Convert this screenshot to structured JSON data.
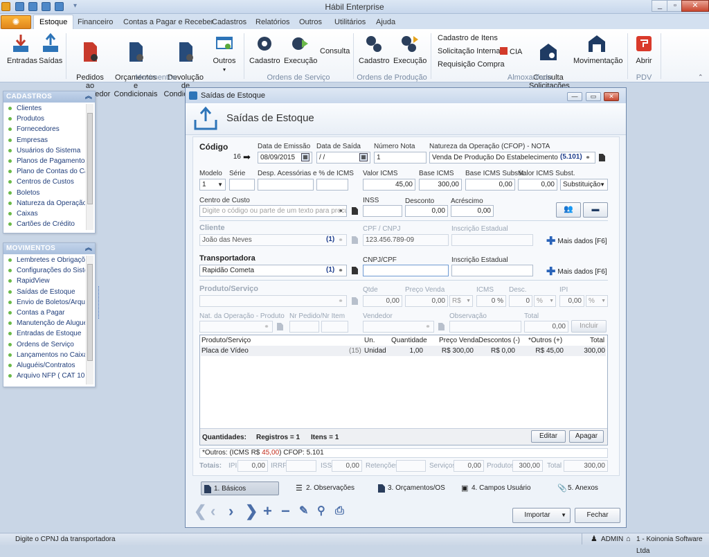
{
  "app": {
    "title": "Hábil Enterprise",
    "window_buttons": [
      "_",
      "▫",
      "✕"
    ]
  },
  "ribbon_tabs": [
    "Estoque",
    "Financeiro",
    "Contas a Pagar e Receber",
    "Cadastros",
    "Relatórios",
    "Outros",
    "Utilitários",
    "Ajuda"
  ],
  "ribbon": {
    "entradas": "Entradas",
    "saidas": "Saídas",
    "pedidos": "Pedidos ao\nFornecedor",
    "orcamentos": "Orçamentos e\nCondicionais",
    "devolucao": "Devolução de\nCondicionais",
    "outros": "Outros",
    "movimentos_group": "Movimentos",
    "os_cadastro": "Cadastro",
    "os_execucao": "Execução",
    "os_consulta": "Consulta",
    "os_group": "Ordens de Serviço",
    "op_cadastro": "Cadastro",
    "op_execucao": "Execução",
    "op_group": "Ordens de Produção",
    "cadastro_itens": "Cadastro de Itens",
    "solicitacao_interna": "Solicitação Interna",
    "cia": "CIA",
    "requisicao": "Requisição Compra",
    "consulta_solicitacoes": "Consulta\nSolicitações",
    "movimentacao": "Movimentação",
    "almox_group": "Almoxarifado",
    "abrir": "Abrir",
    "pdv_group": "PDV"
  },
  "cadastros_panel": {
    "title": "CADASTROS",
    "items": [
      "Clientes",
      "Produtos",
      "Fornecedores",
      "Empresas",
      "Usuários do Sistema",
      "Planos de Pagamentos",
      "Plano de Contas do Ca...",
      "Centros de Custos",
      "Boletos",
      "Natureza da Operação",
      "Caixas",
      "Cartões de Crédito"
    ]
  },
  "movimentos_panel": {
    "title": "MOVIMENTOS",
    "items": [
      "Lembretes e Obrigaçõ...",
      "Configurações do Siste...",
      "RapidView",
      "Saídas de Estoque",
      "Envio de Boletos/Arqui...",
      "Contas a Pagar",
      "Manutenção de Alugué...",
      "Entradas de Estoque",
      "Ordens de Serviço",
      "Lançamentos no Caixa",
      "Aluguéis/Contratos",
      "Arquivo NFP ( CAT 102..."
    ]
  },
  "dialog": {
    "window_title": "Saídas de Estoque",
    "header": "Saídas de Estoque",
    "codigo_label": "Código",
    "codigo": "16",
    "data_emissao_label": "Data de Emissão",
    "data_emissao": "08/09/2015",
    "data_saida_label": "Data de Saída",
    "data_saida": " /  /",
    "numero_nota_label": "Número Nota",
    "numero_nota": "1",
    "natureza_label": "Natureza da Operação (CFOP) - NOTA",
    "natureza": "Venda De Produção Do Estabelecimento",
    "natureza_code": "(5.101)",
    "modelo_label": "Modelo",
    "modelo": "1",
    "serie_label": "Série",
    "desp_label": "Desp. Acessórias e % de ICMS",
    "valor_icms_label": "Valor ICMS",
    "valor_icms": "45,00",
    "base_icms_label": "Base ICMS",
    "base_icms": "300,00",
    "base_icms_subst_label": "Base ICMS Substit.",
    "base_icms_subst": "0,00",
    "valor_icms_subst_label": "Valor ICMS Subst.",
    "valor_icms_subst": "0,00",
    "substituicao": "Substituição",
    "centro_custo_label": "Centro de Custo",
    "centro_custo_placeholder": "Digite o código ou parte de um texto para procurar",
    "inss_label": "INSS",
    "desconto_label": "Desconto",
    "desconto": "0,00",
    "acrescimo_label": "Acréscimo",
    "acrescimo": "0,00",
    "cliente_label": "Cliente",
    "cliente": "João das Neves",
    "cliente_count": "(1)",
    "cpf_cnpj_label": "CPF / CNPJ",
    "cpf_cnpj": "123.456.789-09",
    "inscricao_label": "Inscrição Estadual",
    "mais_dados": "Mais dados [F6]",
    "transportadora_label": "Transportadora",
    "transportadora": "Rapidão Cometa",
    "transportadora_count": "(1)",
    "cnpj_cpf_label": "CNPJ/CPF",
    "produto_label": "Produto/Serviço",
    "qtde_label": "Qtde",
    "qtde": "0,00",
    "preco_venda_label": "Preço Venda",
    "preco_venda": "0,00",
    "moeda": "R$",
    "icms_label": "ICMS",
    "icms": "0 %",
    "desc_label": "Desc.",
    "desc": "0",
    "pct": "%",
    "ipi_label": "IPI",
    "ipi": "0,00",
    "nat_produto_label": "Nat. da Operação - Produto",
    "nr_pedido_label": "Nr Pedido/Nr Item",
    "vendedor_label": "Vendedor",
    "observacao_label": "Observação",
    "total_label": "Total",
    "total": "0,00",
    "incluir": "Incluir",
    "grid_headers": [
      "Produto/Serviço",
      "Un.",
      "Quantidade",
      "Preço Venda",
      "Descontos (-)",
      "*Outros (+)",
      "Total"
    ],
    "grid_row": {
      "produto": "Placa de Vídeo",
      "ref": "(15)",
      "un": "Unidad",
      "quantidade": "1,00",
      "preco": "R$ 300,00",
      "descontos": "R$ 0,00",
      "outros": "R$ 45,00",
      "total": "300,00"
    },
    "quantidades": "Quantidades:",
    "registros": "Registros = 1",
    "itens": "Itens = 1",
    "editar": "Editar",
    "apagar": "Apagar",
    "outros_note_a": "*Outros: (ICMS R$ ",
    "outros_note_val": "45,00",
    "outros_note_b": ")  CFOP: 5.101",
    "totais_label": "Totais:",
    "ipi_t_label": "IPI",
    "ipi_t": "0,00",
    "irrf_label": "IRRF",
    "iss_label": "ISS",
    "iss": "0,00",
    "retencoes_label": "Retenções",
    "servicos_label": "Serviços",
    "servicos": "0,00",
    "produtos_label": "Produtos",
    "produtos": "300,00",
    "total_t_label": "Total",
    "total_t": "300,00",
    "tabs": [
      "1. Básicos",
      "2. Observações",
      "3. Orçamentos/OS",
      "4. Campos Usuário",
      "5. Anexos"
    ],
    "importar": "Importar",
    "fechar": "Fechar"
  },
  "status": {
    "hint": "Digite o CPNJ da transportadora",
    "user": "ADMIN",
    "company": "1 - Koinonia Software Ltda"
  },
  "colors": {
    "accent": "#2a63b8",
    "orb": "#f0a028",
    "close": "#c9472f"
  }
}
